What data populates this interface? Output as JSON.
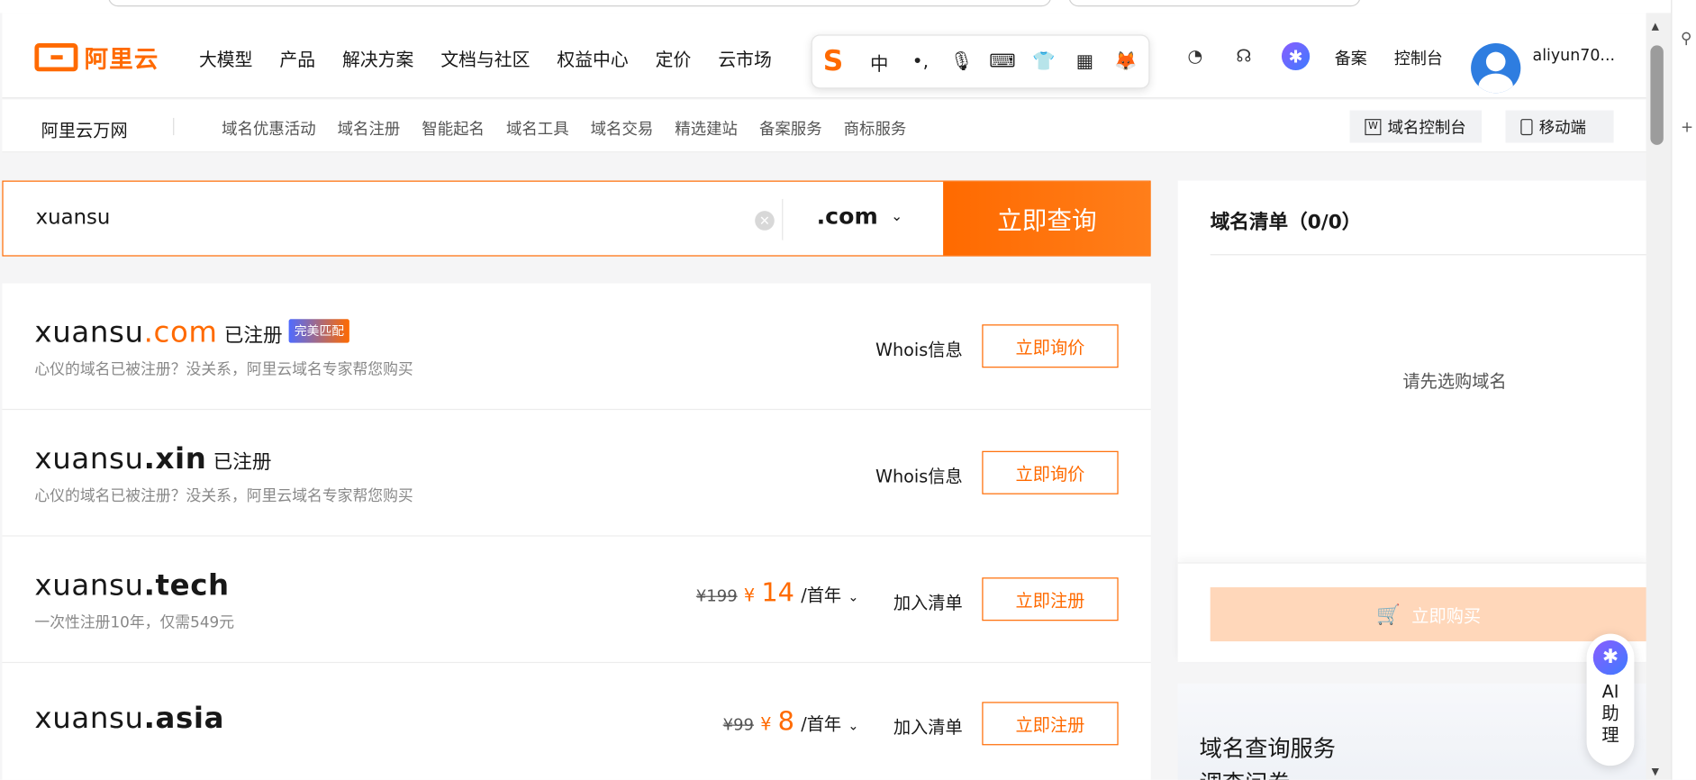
{
  "header": {
    "logo_text": "阿里云",
    "nav": [
      "大模型",
      "产品",
      "解决方案",
      "文档与社区",
      "权益中心",
      "定价",
      "云市场"
    ],
    "ime": {
      "zh": "中",
      "dot": "•,"
    },
    "beian": "备案",
    "console": "控制台",
    "username": "aliyun70..."
  },
  "subnav": {
    "title": "阿里云万网",
    "links": [
      "域名优惠活动",
      "域名注册",
      "智能起名",
      "域名工具",
      "域名交易",
      "精选建站",
      "备案服务",
      "商标服务"
    ],
    "console_btn": "域名控制台",
    "mobile_btn": "移动端",
    "console_icon": "W"
  },
  "search": {
    "value": "xuansu",
    "tld": ".com",
    "button": "立即查询"
  },
  "results": [
    {
      "name": "xuansu",
      "tld": ".com",
      "status": "已注册",
      "badge": "完美匹配",
      "desc": "心仪的域名已被注册？没关系，阿里云域名专家帮您购买",
      "whois": "Whois信息",
      "button": "立即询价"
    },
    {
      "name": "xuansu",
      "tld": ".xin",
      "status": "已注册",
      "desc": "心仪的域名已被注册？没关系，阿里云域名专家帮您购买",
      "whois": "Whois信息",
      "button": "立即询价"
    },
    {
      "name": "xuansu",
      "tld": ".tech",
      "desc": "一次性注册10年，仅需549元",
      "old_price": "¥199",
      "yen": "¥",
      "price": "14",
      "unit": "/首年",
      "add": "加入清单",
      "button": "立即注册"
    },
    {
      "name": "xuansu",
      "tld": ".asia",
      "old_price": "¥99",
      "yen": "¥",
      "price": "8",
      "unit": "/首年",
      "add": "加入清单",
      "button": "立即注册"
    }
  ],
  "cart": {
    "title": "域名清单（0/0）",
    "empty": "请先选购域名",
    "buy": "立即购买"
  },
  "service": {
    "title": "域名查询服务",
    "sub": "调查问卷"
  },
  "ai": {
    "label": "AI助理"
  },
  "colors": {
    "accent": "#ff6a00",
    "disabled_btn": "#ffd7ba"
  }
}
